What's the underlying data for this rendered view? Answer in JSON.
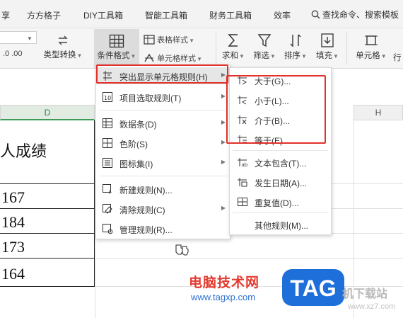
{
  "ribbon_tabs": [
    "享",
    "方方格子",
    "DIY工具箱",
    "智能工具箱",
    "财务工具箱",
    "效率"
  ],
  "search": {
    "label": "查找命令、搜索模板"
  },
  "ribbon": {
    "number_format_hint": ".0 .00",
    "type_convert": "类型转换",
    "conditional_format": "条件格式",
    "table_style": "表格样式",
    "cell_style": "单元格样式",
    "sum": "求和",
    "filter": "筛选",
    "sort": "排序",
    "fill": "填充",
    "cell": "单元格",
    "row_col": "行"
  },
  "columns": {
    "d": "D",
    "h": "H"
  },
  "sheet": {
    "title_cell": "人成绩",
    "values": [
      "167",
      "184",
      "173",
      "164"
    ]
  },
  "cond_menu": {
    "items": [
      {
        "label": "突出显示单元格规则(H)",
        "submenu": true
      },
      {
        "label": "项目选取规则(T)",
        "submenu": true
      },
      {
        "label": "数据条(D)",
        "submenu": true
      },
      {
        "label": "色阶(S)",
        "submenu": true
      },
      {
        "label": "图标集(I)",
        "submenu": true
      },
      {
        "label": "新建规则(N)...",
        "submenu": false
      },
      {
        "label": "清除规则(C)",
        "submenu": true
      },
      {
        "label": "管理规则(R)...",
        "submenu": false
      }
    ]
  },
  "highlight_submenu": {
    "items": [
      "大于(G)...",
      "小于(L)...",
      "介于(B)...",
      "等于(E)...",
      "文本包含(T)...",
      "发生日期(A)...",
      "重复值(D)...",
      "其他规则(M)..."
    ]
  },
  "watermark": {
    "site_cn": "电脑技术网",
    "url": "www.tagxp.com",
    "logo": "TAG",
    "right_text": "机下载站",
    "right_url": "www.xz7.com"
  },
  "colors": {
    "highlight_box": "#e0312b",
    "accent_green": "#3f9a5a",
    "logo_blue": "#1e6fd9"
  }
}
